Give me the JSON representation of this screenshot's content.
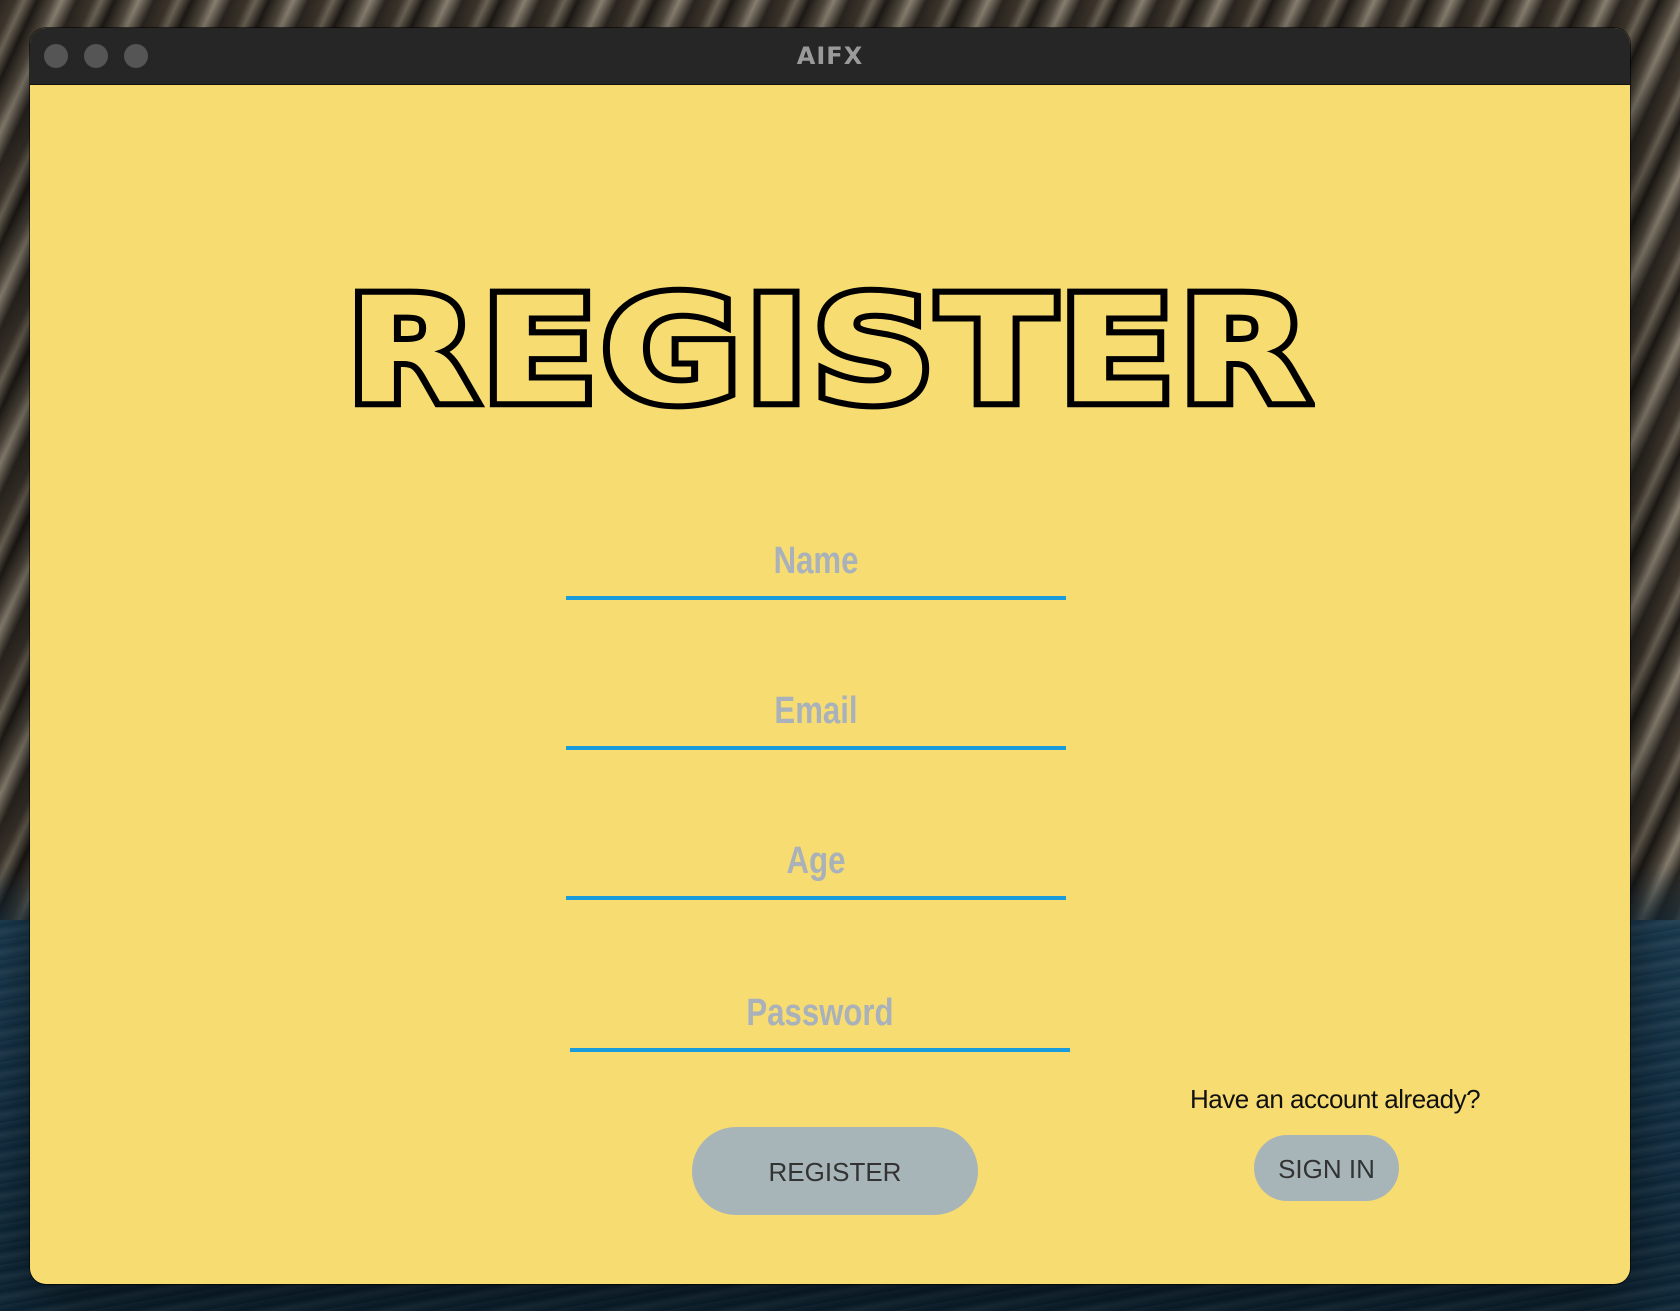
{
  "window": {
    "title": "AIFX"
  },
  "register": {
    "heading": "REGISTER",
    "fields": {
      "name": {
        "placeholder": "Name",
        "value": ""
      },
      "email": {
        "placeholder": "Email",
        "value": ""
      },
      "age": {
        "placeholder": "Age",
        "value": ""
      },
      "password": {
        "placeholder": "Password",
        "value": ""
      }
    },
    "register_label": "REGISTER",
    "have_account_text": "Have an account already?",
    "signin_label": "SIGN IN"
  },
  "colors": {
    "background": "#f7dc72",
    "field_underline": "#1a9bdc",
    "placeholder": "#a9b1ba",
    "button": "#a8b5b8",
    "titlebar": "#262626"
  }
}
